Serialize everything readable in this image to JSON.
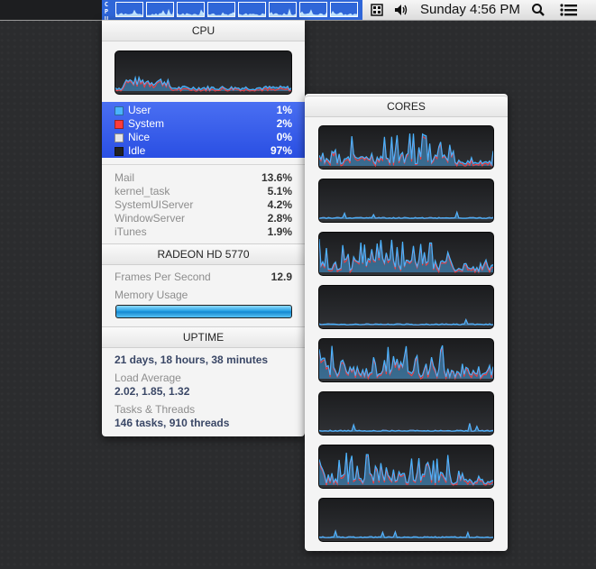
{
  "menubar": {
    "cpu_vertical_label": "CPU",
    "clock": "Sunday 4:56 PM",
    "icons": [
      "stats-icon",
      "volume-icon",
      "search-icon",
      "list-icon"
    ]
  },
  "cpu": {
    "header": "CPU",
    "legend": [
      {
        "name": "User",
        "percent": "1%",
        "color": "#4ab3ff"
      },
      {
        "name": "System",
        "percent": "2%",
        "color": "#ff3b3b"
      },
      {
        "name": "Nice",
        "percent": "0%",
        "color": "#e6e6e6"
      },
      {
        "name": "Idle",
        "percent": "97%",
        "color": "#222222"
      }
    ],
    "processes": [
      {
        "name": "Mail",
        "value": "13.6%"
      },
      {
        "name": "kernel_task",
        "value": "5.1%"
      },
      {
        "name": "SystemUIServer",
        "value": "4.2%"
      },
      {
        "name": "WindowServer",
        "value": "2.8%"
      },
      {
        "name": "iTunes",
        "value": "1.9%"
      }
    ]
  },
  "gpu": {
    "header": "RADEON HD 5770",
    "fps_label": "Frames Per Second",
    "fps_value": "12.9",
    "memory_label": "Memory Usage",
    "memory_usage_fraction": 1.0
  },
  "uptime": {
    "header": "UPTIME",
    "duration": "21 days, 18 hours, 38 minutes",
    "load_label": "Load Average",
    "load_value": "2.02, 1.85, 1.32",
    "tasks_label": "Tasks & Threads",
    "tasks_value": "146 tasks, 910 threads"
  },
  "cores": {
    "header": "CORES",
    "count": 8,
    "activity": [
      "high",
      "low",
      "high",
      "low",
      "high",
      "low",
      "high",
      "low"
    ]
  },
  "colors": {
    "accent_blue": "#2f66d8",
    "graph_user": "#4ab3ff",
    "graph_system": "#ff3b3b"
  }
}
